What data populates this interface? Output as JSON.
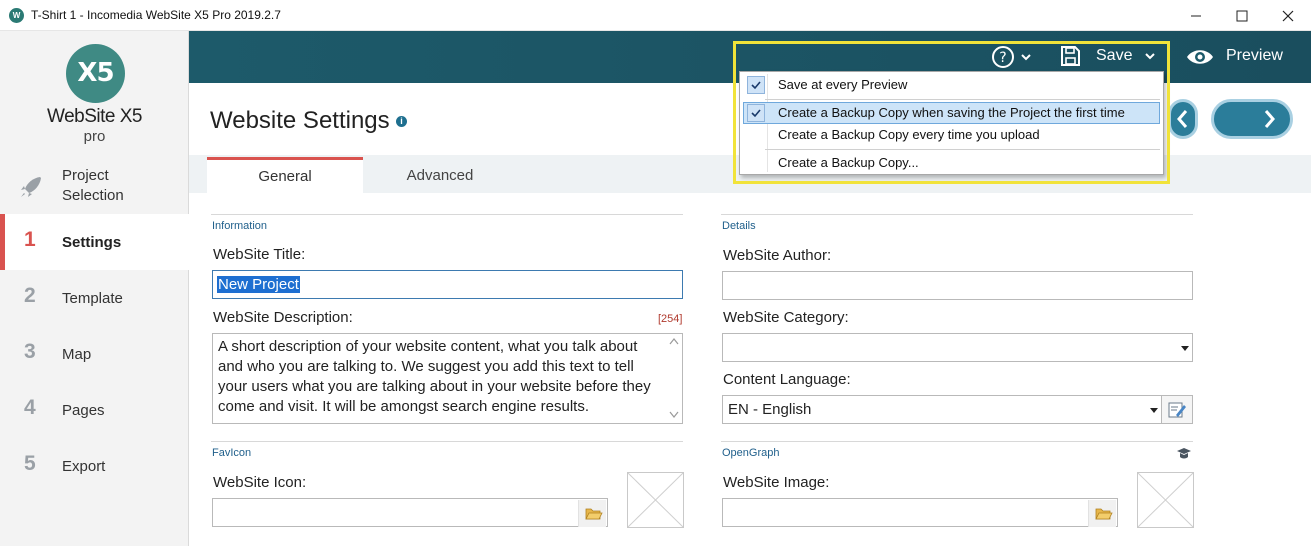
{
  "window": {
    "title": "T-Shirt 1 - Incomedia WebSite X5 Pro 2019.2.7",
    "app_icon_text": "W"
  },
  "logo": {
    "mark": "X5",
    "name": "WebSite X5",
    "edition": "pro"
  },
  "sidebar": {
    "items": [
      {
        "num": "",
        "label": "Project Selection",
        "icon": "rocket-icon"
      },
      {
        "num": "1",
        "label": "Settings"
      },
      {
        "num": "2",
        "label": "Template"
      },
      {
        "num": "3",
        "label": "Map"
      },
      {
        "num": "4",
        "label": "Pages"
      },
      {
        "num": "5",
        "label": "Export"
      }
    ]
  },
  "toolbar": {
    "help_icon": "help-icon",
    "save_label": "Save",
    "preview_label": "Preview"
  },
  "save_menu": {
    "items": [
      {
        "label": "Save at every Preview",
        "checked": true
      },
      {
        "label": "Create a Backup Copy when saving the Project the first time",
        "checked": true,
        "highlighted": true
      },
      {
        "label": "Create a Backup Copy every time you upload",
        "checked": false
      },
      {
        "label": "Create a Backup Copy...",
        "checked": false
      }
    ]
  },
  "page": {
    "title": "Website Settings"
  },
  "tabs": [
    {
      "label": "General",
      "active": true
    },
    {
      "label": "Advanced",
      "active": false
    }
  ],
  "information": {
    "section": "Information",
    "title_label": "WebSite Title:",
    "title_value": "New Project",
    "description_label": "WebSite Description:",
    "description_counter": "[254]",
    "description_value": "A short description of your website content, what you talk about and who you are talking to. We suggest you add  this text to tell your users what you are talking about in your website before they come and visit. It will be amongst search engine results."
  },
  "details": {
    "section": "Details",
    "author_label": "WebSite Author:",
    "author_value": "",
    "category_label": "WebSite Category:",
    "category_value": "",
    "language_label": "Content Language:",
    "language_value": "EN - English"
  },
  "favicon": {
    "section": "FavIcon",
    "icon_label": "WebSite Icon:",
    "icon_value": ""
  },
  "opengraph": {
    "section": "OpenGraph",
    "image_label": "WebSite Image:",
    "image_value": ""
  },
  "colors": {
    "accent": "#d9534f",
    "header": "#1d5a6a",
    "link": "#1f5f8b",
    "highlight": "#f1e33a"
  }
}
